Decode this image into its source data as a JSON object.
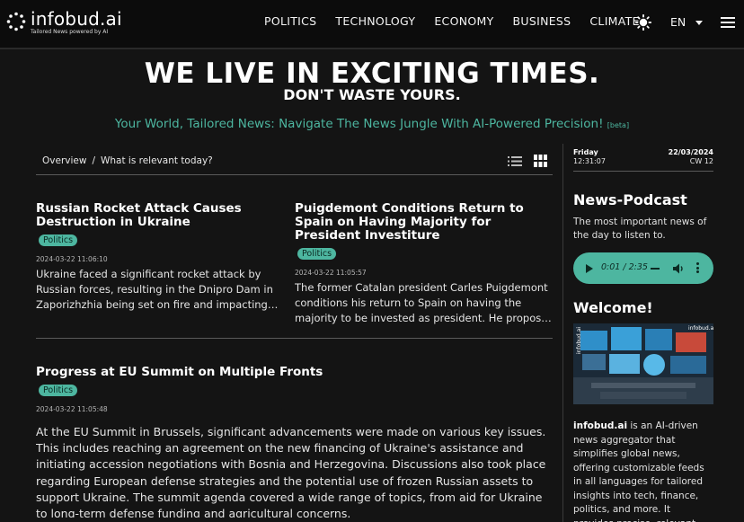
{
  "header": {
    "brand": "infobud.ai",
    "brand_tagline": "Tailored News powered by AI",
    "nav": [
      "POLITICS",
      "TECHNOLOGY",
      "ECONOMY",
      "BUSINESS",
      "CLIMATE"
    ],
    "language": "EN",
    "icons": {
      "theme": "sun-icon",
      "language": "chevron-down-icon",
      "menu": "hamburger-menu-icon"
    }
  },
  "hero": {
    "headline": "WE LIVE IN EXCITING TIMES.",
    "subheadline": "DON'T WASTE YOURS.",
    "tagline": "Your World, Tailored News: Navigate The News Jungle With AI-Powered Precision!",
    "beta": "[beta]"
  },
  "breadcrumb": {
    "root": "Overview",
    "separator": "/",
    "current": "What is relevant today?"
  },
  "articles": [
    {
      "title": "Russian Rocket Attack Causes Destruction in Ukraine",
      "tag": "Politics",
      "timestamp": "2024-03-22 11:06:10",
      "excerpt": "Ukraine faced a significant rocket attack by Russian forces, resulting in the Dnipro Dam in Zaporizhzhia being set on fire and impacting the energy infrastructure across the country."
    },
    {
      "title": "Puigdemont Conditions Return to Spain on Having Majority for President Investiture",
      "tag": "Politics",
      "timestamp": "2024-03-22 11:05:57",
      "excerpt": "The former Catalan president Carles Puigdemont conditions his return to Spain on having the majority to be invested as president. He proposes to return only if the numbers add up."
    },
    {
      "title": "Progress at EU Summit on Multiple Fronts",
      "tag": "Politics",
      "timestamp": "2024-03-22 11:05:48",
      "excerpt": "At the EU Summit in Brussels, significant advancements were made on various key issues. This includes reaching an agreement on the new financing of Ukraine's assistance and initiating accession negotiations with Bosnia and Herzegovina. Discussions also took place regarding European defense strategies and the potential use of frozen Russian assets to support Ukraine. The summit agenda covered a wide range of topics, from aid for Ukraine to long-term defense funding and agricultural concerns."
    }
  ],
  "sidebar": {
    "day": "Friday",
    "time": "12:31:07",
    "date": "22/03/2024",
    "week": "CW 12",
    "podcast_title": "News-Podcast",
    "podcast_desc": "The most important news of the day to listen to.",
    "player_time": "0:01 / 2:35",
    "welcome_title": "Welcome!",
    "image_caption": "infobud.ai",
    "about_brand": "infobud.ai",
    "about_text": " is an AI-driven news aggregator that simplifies global news, offering customizable feeds in all languages for tailored insights into tech, finance, politics, and more. It provides precise, relevant news updates."
  },
  "colors": {
    "accent": "#4db6a0",
    "background": "#141414",
    "header": "#0c0c0c"
  }
}
